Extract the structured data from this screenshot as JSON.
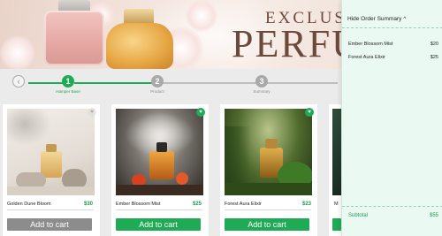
{
  "banner": {
    "title_line1": "EXCLUSIVE",
    "title_line2": "PERFUM"
  },
  "stepper": {
    "back_icon": "chevron-left-icon",
    "steps": [
      {
        "number": "1",
        "label": "Hamper Base",
        "state": "active"
      },
      {
        "number": "2",
        "label": "Product",
        "state": "inactive"
      },
      {
        "number": "3",
        "label": "Summary",
        "state": "inactive"
      }
    ]
  },
  "products": [
    {
      "name": "Golden Dune Bloom",
      "price": "$30",
      "button": "Add to cart",
      "favorited": false,
      "button_state": "disabled"
    },
    {
      "name": "Ember Blossom Mist",
      "price": "$25",
      "button": "Add to cart",
      "favorited": true,
      "button_state": "enabled"
    },
    {
      "name": "Forest Aura Elixir",
      "price": "$23",
      "button": "Add to cart",
      "favorited": true,
      "button_state": "enabled"
    },
    {
      "name": "M",
      "price": "",
      "button": "",
      "favorited": false,
      "button_state": "enabled"
    }
  ],
  "summary": {
    "toggle_label": "Hide Order Summary",
    "toggle_icon": "chevron-up-icon",
    "items": [
      {
        "name": "Ember Blossom Mist",
        "price": "$20"
      },
      {
        "name": "Forest Aura Elixir",
        "price": "$25"
      }
    ],
    "subtotal_label": "Subtotal",
    "subtotal_value": "$55"
  },
  "colors": {
    "accent_green": "#1faa55",
    "price_green": "#1e9a4e",
    "disabled_gray": "#8c8c8c",
    "inactive_step": "#a9a9a9",
    "summary_bg": "#eafaf2"
  }
}
